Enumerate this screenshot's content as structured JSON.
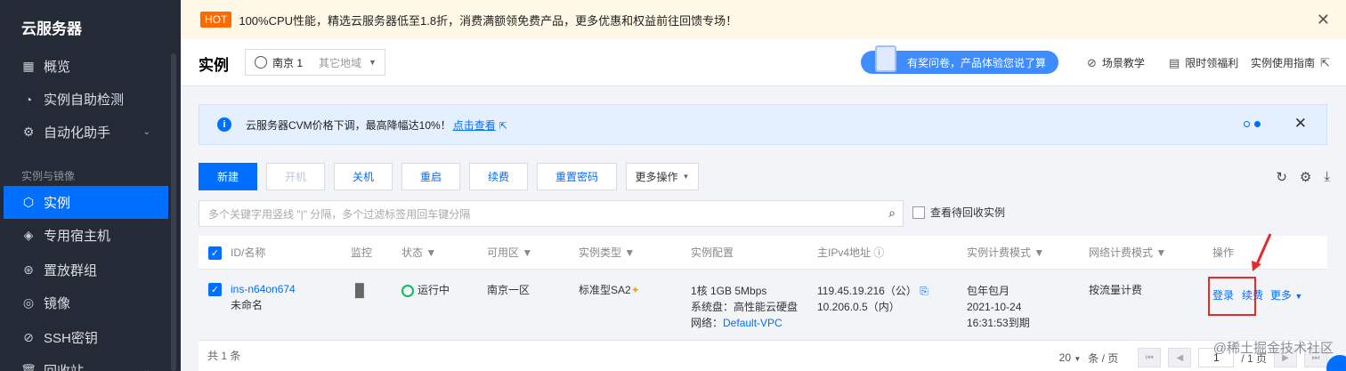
{
  "sidebar": {
    "title": "云服务器",
    "items": [
      {
        "label": "概览",
        "icon": "grid-icon"
      },
      {
        "label": "实例自助检测",
        "icon": "gauge-icon"
      },
      {
        "label": "自动化助手",
        "icon": "robot-icon"
      },
      {
        "label": "实例",
        "icon": "cube-icon"
      },
      {
        "label": "专用宿主机",
        "icon": "layers-icon"
      },
      {
        "label": "置放群组",
        "icon": "group-icon"
      },
      {
        "label": "镜像",
        "icon": "disc-icon"
      },
      {
        "label": "SSH密钥",
        "icon": "key-icon"
      },
      {
        "label": "回收站",
        "icon": "trash-icon"
      }
    ],
    "group_label": "实例与镜像"
  },
  "hotbar": {
    "tag": "HOT",
    "text": "100%CPU性能，精选云服务器低至1.8折，消费满额领免费产品，更多优惠和权益前往回馈专场！",
    "close": "✕"
  },
  "header": {
    "title": "实例",
    "region": "南京 1",
    "other_region": "其它地域",
    "survey": "有奖问卷，产品体验您说了算",
    "links": [
      "场景教学",
      "限时领福利",
      "实例使用指南"
    ]
  },
  "notice": {
    "info": "i",
    "text": "云服务器CVM价格下调，最高降幅达10%！",
    "link": "点击查看",
    "close": "✕"
  },
  "toolbar": {
    "new": "新建",
    "start": "开机",
    "shutdown": "关机",
    "restart": "重启",
    "renew": "续费",
    "reset_pwd": "重置密码",
    "more": "更多操作"
  },
  "search": {
    "placeholder": "多个关键字用竖线 \"|\" 分隔，多个过滤标签用回车键分隔",
    "recycle_label": "查看待回收实例"
  },
  "table": {
    "headers": [
      "ID/名称",
      "监控",
      "状态",
      "可用区",
      "实例类型",
      "实例配置",
      "主IPv4地址",
      "实例计费模式",
      "网络计费模式",
      "操作"
    ],
    "row": {
      "id": "ins-n64on674",
      "name": "未命名",
      "status": "运行中",
      "zone": "南京一区",
      "type": "标准型SA2",
      "config1": "1核 1GB 5Mbps",
      "config2": "系统盘：高性能云硬盘",
      "config3_label": "网络：",
      "config3_link": "Default-VPC",
      "ip_public": "119.45.19.216（公）",
      "ip_private": "10.206.0.5（内）",
      "billing": "包年包月",
      "billing_date": "2021-10-24",
      "billing_time": "16:31:53到期",
      "net_billing": "按流量计费",
      "action_login": "登录",
      "action_renew": "续费",
      "action_more": "更多"
    },
    "total": "共 1 条",
    "page_size": "20",
    "page_size_unit": "条 / 页",
    "page": "1",
    "page_total": "/ 1 页"
  },
  "watermark": "@稀土掘金技术社区",
  "colors": {
    "accent": "#006eff",
    "sidebar": "#252b36",
    "highlight": "#e22b2b"
  }
}
